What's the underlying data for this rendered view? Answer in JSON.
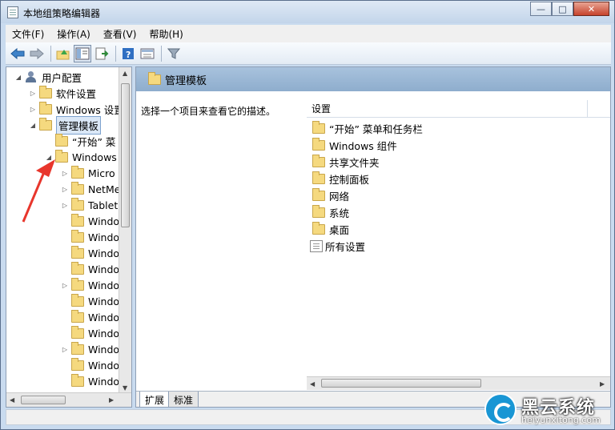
{
  "window": {
    "title": "本地组策略编辑器",
    "min": "—",
    "max": "□",
    "close": "✕"
  },
  "menu": [
    "文件(F)",
    "操作(A)",
    "查看(V)",
    "帮助(H)"
  ],
  "tree": [
    {
      "label": "用户配置",
      "icon": "user-icon",
      "arrow": "◢"
    },
    {
      "label": "软件设置",
      "icon": "folder-icon",
      "arrow": "▷"
    },
    {
      "label": "Windows 设置",
      "icon": "folder-icon",
      "arrow": "▷"
    },
    {
      "label": "管理模板",
      "icon": "folder-icon",
      "arrow": "◢"
    },
    {
      "label": "“开始” 菜",
      "icon": "folder-icon",
      "arrow": ""
    },
    {
      "label": "Windows",
      "icon": "folder-icon",
      "arrow": "◢"
    },
    {
      "label": "Micro",
      "icon": "folder-icon",
      "arrow": "▷"
    },
    {
      "label": "NetMe",
      "icon": "folder-icon",
      "arrow": "▷"
    },
    {
      "label": "Tablet",
      "icon": "folder-icon",
      "arrow": "▷"
    },
    {
      "label": "Windo",
      "icon": "folder-icon",
      "arrow": ""
    },
    {
      "label": "Windo",
      "icon": "folder-icon",
      "arrow": ""
    },
    {
      "label": "Windo",
      "icon": "folder-icon",
      "arrow": ""
    },
    {
      "label": "Windo",
      "icon": "folder-icon",
      "arrow": ""
    },
    {
      "label": "Windo",
      "icon": "folder-icon",
      "arrow": "▷"
    },
    {
      "label": "Windo",
      "icon": "folder-icon",
      "arrow": ""
    },
    {
      "label": "Windo",
      "icon": "folder-icon",
      "arrow": ""
    },
    {
      "label": "Windo",
      "icon": "folder-icon",
      "arrow": ""
    },
    {
      "label": "Windo",
      "icon": "folder-icon",
      "arrow": "▷"
    },
    {
      "label": "Windo",
      "icon": "folder-icon",
      "arrow": ""
    },
    {
      "label": "Windo",
      "icon": "folder-icon",
      "arrow": ""
    }
  ],
  "right": {
    "header": "管理模板",
    "description": "选择一个项目来查看它的描述。",
    "column": "设置",
    "items": [
      {
        "label": "“开始” 菜单和任务栏",
        "icon": "folder-icon"
      },
      {
        "label": "Windows 组件",
        "icon": "folder-icon"
      },
      {
        "label": "共享文件夹",
        "icon": "folder-icon"
      },
      {
        "label": "控制面板",
        "icon": "folder-icon"
      },
      {
        "label": "网络",
        "icon": "folder-icon"
      },
      {
        "label": "系统",
        "icon": "folder-icon"
      },
      {
        "label": "桌面",
        "icon": "folder-icon"
      },
      {
        "label": "所有设置",
        "icon": "settings-icon"
      }
    ]
  },
  "tabs": [
    "扩展",
    "标准"
  ],
  "watermark": {
    "title": "黑云系统",
    "url": "heiyunxitong.com"
  }
}
